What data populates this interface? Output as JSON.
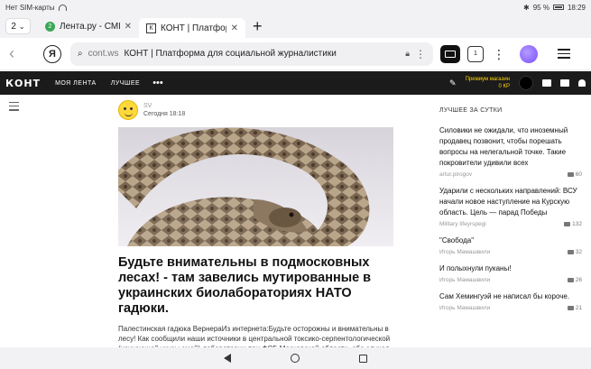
{
  "statusbar": {
    "carrier": "Нет SIM-карты",
    "battery": "95 %",
    "time": "18:29"
  },
  "tabs": {
    "count": "2",
    "items": [
      {
        "label": "Лента.ру - СМИ2",
        "favicon": "2"
      },
      {
        "label": "КОНТ | Платформ",
        "favicon": "К"
      }
    ]
  },
  "address": {
    "domain": "cont.ws",
    "title": "КОНТ | Платформа для социальной журналистики",
    "ya_label": "Я",
    "tabs_icon_label": "1"
  },
  "site_nav": {
    "logo": "КОНТ",
    "items": [
      "МОЯ ЛЕНТА",
      "ЛУЧШЕЕ"
    ],
    "more": "•••",
    "premium_label": "Премиум магазин",
    "premium_balance": "0 КР"
  },
  "post": {
    "author": "SV",
    "time": "Сегодня 18:18",
    "headline": "Будьте внимательны в подмосковных лесах! - там завелись мутированные в украинских биолабораториях НАТО гадюки.",
    "excerpt": "Палестинская гадюка ВернераИз интернета:Будьте осторожны и внимательны в лесу! Как сообщили наши источники в центральной токсико-серпентологической (изучающей укусы змей) лаборатории при ФСБ Московской области, оба случая укусов людей гадюками на этой неделе дали очень странные результаты"
  },
  "sidebar": {
    "heading": "ЛУЧШЕЕ ЗА СУТКИ",
    "items": [
      {
        "title": "Силовики не ожидали, что иноземный продавец позвонит, чтобы порешать вопросы на нелегальной точке. Такие покровители удивили всех",
        "author": "artur.pirogov",
        "comments": "60"
      },
      {
        "title": "Ударили с нескольких направлений: ВСУ начали новое наступление на Курскую область. Цель — парад Победы",
        "author": "Military lifeyrspegi",
        "comments": "132"
      },
      {
        "title": "\"Свобода\"",
        "author": "Игорь Мамашвили",
        "comments": "32"
      },
      {
        "title": "И полыхнули пуканы!",
        "author": "Игорь Мамашвили",
        "comments": "26"
      },
      {
        "title": "Сам Хемингуэй не написал бы короче.",
        "author": "Игорь Мамашвили",
        "comments": "21"
      }
    ]
  }
}
